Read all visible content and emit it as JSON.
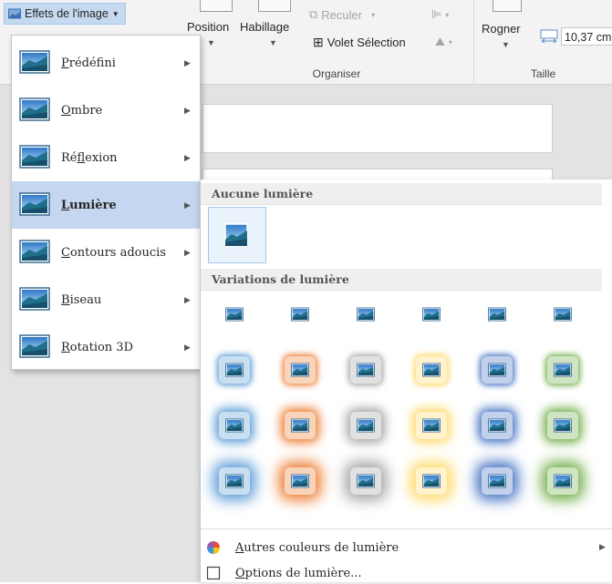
{
  "ribbon": {
    "effects_button": "Effets de l'image",
    "position": "Position",
    "wrap": "Habillage",
    "send_backward": "Reculer",
    "selection_pane": "Volet Sélection",
    "group_arrange": "Organiser",
    "crop": "Rogner",
    "width_value": "10,37 cm",
    "group_size": "Taille"
  },
  "menu": {
    "active_index": 3,
    "items": [
      {
        "label": "Prédéfini",
        "accel_pre": "",
        "accel": "P",
        "rest": "rédéfini"
      },
      {
        "label": "Ombre",
        "accel_pre": "",
        "accel": "O",
        "rest": "mbre"
      },
      {
        "label": "Réflexion",
        "accel_pre": "Ré",
        "accel": "f",
        "rest": "lexion"
      },
      {
        "label": "Lumière",
        "accel_pre": "",
        "accel": "L",
        "rest": "umière"
      },
      {
        "label": "Contours adoucis",
        "accel_pre": "",
        "accel": "C",
        "rest": "ontours adoucis"
      },
      {
        "label": "Biseau",
        "accel_pre": "",
        "accel": "B",
        "rest": "iseau"
      },
      {
        "label": "Rotation 3D",
        "accel_pre": "",
        "accel": "R",
        "rest": "otation 3D"
      }
    ]
  },
  "submenu": {
    "no_glow_header": "Aucune lumière",
    "variations_header": "Variations de lumière",
    "glow_colors": [
      "#5b9bd5",
      "#ed7d31",
      "#a5a5a5",
      "#ffd966",
      "#4472c4",
      "#70ad47"
    ],
    "glow_levels": [
      0,
      1,
      2,
      3
    ],
    "more_colors": {
      "label": "Autres couleurs de lumière",
      "accel": "A",
      "rest": "utres couleurs de lumière"
    },
    "options": {
      "label": "Options de lumière...",
      "accel": "O",
      "rest": "ptions de lumière..."
    }
  },
  "icons": {
    "picture": "landscape-picture-icon",
    "palette": "color-palette-icon",
    "options": "options-box-icon",
    "submenu_arrow": "chevron-right-icon"
  }
}
